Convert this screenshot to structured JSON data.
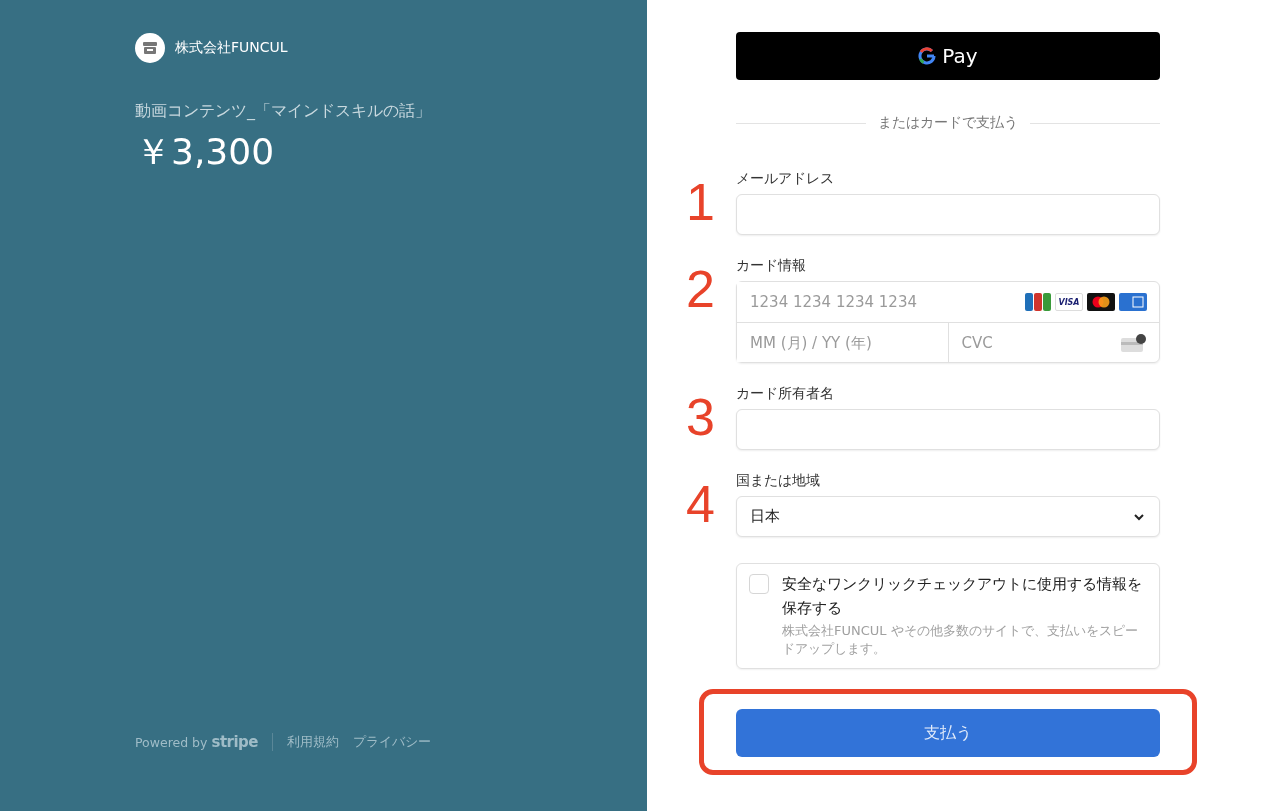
{
  "merchant": {
    "name": "株式会社FUNCUL"
  },
  "product": {
    "name": "動画コンテンツ_「マインドスキルの話」",
    "price": "￥3,300"
  },
  "footer": {
    "powered_by": "Powered by",
    "brand": "stripe",
    "links": [
      "利用規約",
      "プライバシー"
    ]
  },
  "wallet_button": {
    "label": "Pay"
  },
  "divider": {
    "label": "またはカードで支払う"
  },
  "fields": [
    {
      "kind": "text",
      "marker": "1",
      "label": "メールアドレス"
    },
    {
      "kind": "card",
      "marker": "2",
      "label": "カード情報",
      "number_placeholder": "1234 1234 1234 1234",
      "expiry_placeholder": "MM (月) / YY (年)",
      "cvc_placeholder": "CVC",
      "brands": [
        {
          "kind": "jcb"
        },
        {
          "kind": "visa",
          "label": "VISA"
        },
        {
          "kind": "mastercard"
        },
        {
          "kind": "amex"
        }
      ]
    },
    {
      "kind": "text",
      "marker": "3",
      "label": "カード所有者名"
    },
    {
      "kind": "select",
      "marker": "4",
      "label": "国または地域",
      "value": "日本"
    }
  ],
  "save_info": {
    "checked": false,
    "title": "安全なワンクリックチェックアウトに使用する情報を保存する",
    "description": "株式会社FUNCUL やその他多数のサイトで、支払いをスピードアップします。"
  },
  "pay_button": {
    "label": "支払う",
    "highlighted": true
  }
}
